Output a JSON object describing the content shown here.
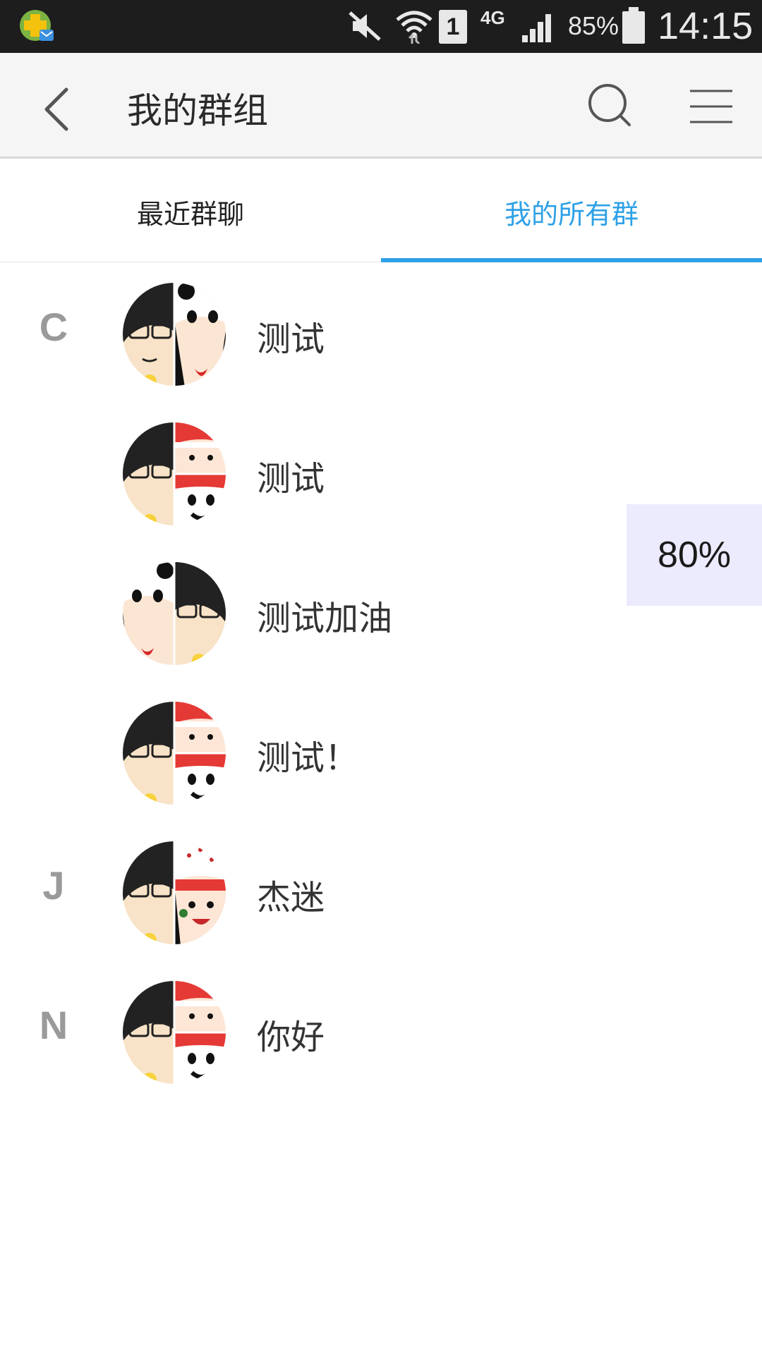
{
  "status_bar": {
    "network_type": "4G",
    "sim_slot": "1",
    "battery_percent": "85%",
    "time": "14:15",
    "icons": [
      "app-notification-icon",
      "mute-icon",
      "wifi-icon",
      "sim-icon",
      "signal-icon",
      "battery-icon"
    ]
  },
  "app_bar": {
    "title": "我的群组",
    "icons": [
      "back-arrow-icon",
      "search-icon",
      "menu-icon"
    ]
  },
  "tabs": [
    {
      "label": "最近群聊",
      "active": false
    },
    {
      "label": "我的所有群",
      "active": true
    }
  ],
  "colors": {
    "accent": "#2ea1e6",
    "status_bar_bg": "#1d1d1d",
    "app_bar_bg": "#f5f5f5",
    "index_letter": "#9a9a9a",
    "zoom_badge_bg": "#eceafd"
  },
  "groups": [
    {
      "index_letter": "C",
      "name": "测试",
      "avatar": "split-avatar-glasses-panda"
    },
    {
      "index_letter": "",
      "name": "测试",
      "avatar": "quad-avatar-glasses-cap-panda"
    },
    {
      "index_letter": "",
      "name": "测试加油",
      "avatar": "split-avatar-panda-glasses"
    },
    {
      "index_letter": "",
      "name": "测试！",
      "avatar": "quad-avatar-glasses-cap-panda"
    },
    {
      "index_letter": "J",
      "name": "杰迷",
      "avatar": "split-avatar-glasses-cap"
    },
    {
      "index_letter": "N",
      "name": "你好",
      "avatar": "quad-avatar-glasses-cap-panda"
    }
  ],
  "zoom_badge": "80%"
}
